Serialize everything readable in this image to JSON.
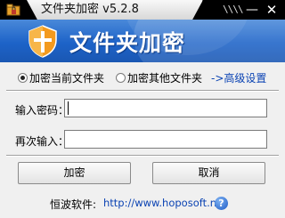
{
  "window": {
    "title": "文件夹加密 v5.2.8",
    "grip_text": "\\\\\\\\",
    "minimize_glyph": "—",
    "close_glyph": "✕"
  },
  "banner": {
    "title": "文件夹加密"
  },
  "options": {
    "radio_current_label": "加密当前文件夹",
    "radio_current_checked": true,
    "radio_other_label": "加密其他文件夹",
    "radio_other_checked": false,
    "advanced_link": "->高级设置"
  },
  "form": {
    "password_label": "输入密码：",
    "password_value": "",
    "confirm_label": "再次输入：",
    "confirm_value": ""
  },
  "buttons": {
    "encrypt_label": "加密",
    "cancel_label": "取消"
  },
  "footer": {
    "company_label": "恒波软件:",
    "url": "http://www.hoposoft.net",
    "help_glyph": "?"
  },
  "colors": {
    "banner_blue": "#1d63c8",
    "link_blue": "#0b43b3",
    "shield_orange": "#f39a1e"
  }
}
